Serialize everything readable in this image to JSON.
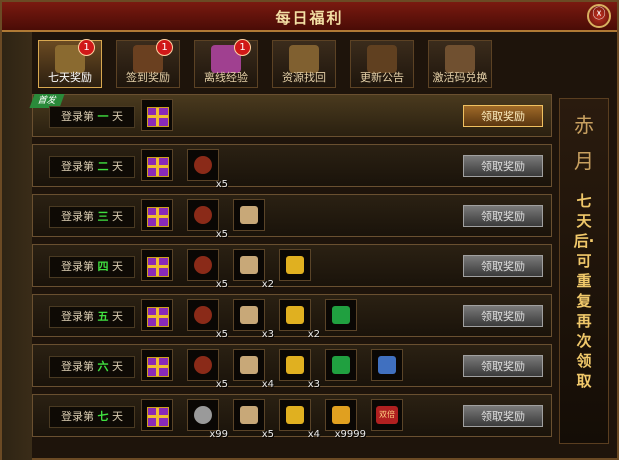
{
  "window": {
    "title": "每日福利",
    "close_label": "ⓧ"
  },
  "tabs": [
    {
      "label": "七天奖励",
      "badge": "1",
      "active": true
    },
    {
      "label": "签到奖励",
      "badge": "1",
      "active": false
    },
    {
      "label": "离线经验",
      "badge": "1",
      "active": false
    },
    {
      "label": "资源找回",
      "badge": "",
      "active": false
    },
    {
      "label": "更新公告",
      "badge": "",
      "active": false
    },
    {
      "label": "激活码兑换",
      "badge": "",
      "active": false
    }
  ],
  "rows": [
    {
      "prefix": "登录第",
      "day": "一",
      "suffix": "天",
      "new_tag": "首发",
      "claim": "领取奖励",
      "items": [
        {
          "icon": "gift-box-icon",
          "qty": ""
        }
      ]
    },
    {
      "prefix": "登录第",
      "day": "二",
      "suffix": "天",
      "claim": "领取奖励",
      "items": [
        {
          "icon": "gift-box-icon",
          "qty": ""
        },
        {
          "icon": "ore-icon",
          "qty": "x5"
        }
      ]
    },
    {
      "prefix": "登录第",
      "day": "三",
      "suffix": "天",
      "claim": "领取奖励",
      "items": [
        {
          "icon": "gift-box-icon",
          "qty": ""
        },
        {
          "icon": "ore-icon",
          "qty": "x5"
        },
        {
          "icon": "scroll-card-icon",
          "qty": ""
        }
      ]
    },
    {
      "prefix": "登录第",
      "day": "四",
      "suffix": "天",
      "claim": "领取奖励",
      "items": [
        {
          "icon": "gift-box-icon",
          "qty": ""
        },
        {
          "icon": "ore-icon",
          "qty": "x5"
        },
        {
          "icon": "scroll-card-icon",
          "qty": "x2"
        },
        {
          "icon": "gold-ingot-icon",
          "qty": ""
        }
      ]
    },
    {
      "prefix": "登录第",
      "day": "五",
      "suffix": "天",
      "claim": "领取奖励",
      "items": [
        {
          "icon": "gift-box-icon",
          "qty": ""
        },
        {
          "icon": "ore-icon",
          "qty": "x5"
        },
        {
          "icon": "scroll-card-icon",
          "qty": "x3"
        },
        {
          "icon": "gold-ingot-icon",
          "qty": "x2"
        },
        {
          "icon": "green-gem-icon",
          "qty": ""
        }
      ]
    },
    {
      "prefix": "登录第",
      "day": "六",
      "suffix": "天",
      "claim": "领取奖励",
      "items": [
        {
          "icon": "gift-box-icon",
          "qty": ""
        },
        {
          "icon": "ore-icon",
          "qty": "x5"
        },
        {
          "icon": "scroll-card-icon",
          "qty": "x4"
        },
        {
          "icon": "gold-ingot-icon",
          "qty": "x3"
        },
        {
          "icon": "green-gem-icon",
          "qty": ""
        },
        {
          "icon": "blue-scroll-icon",
          "qty": ""
        }
      ]
    },
    {
      "prefix": "登录第",
      "day": "七",
      "suffix": "天",
      "claim": "领取奖励",
      "items": [
        {
          "icon": "gift-box-icon",
          "qty": ""
        },
        {
          "icon": "silver-ore-icon",
          "qty": "x99"
        },
        {
          "icon": "scroll-card-icon",
          "qty": "x5"
        },
        {
          "icon": "gold-ingot-icon",
          "qty": "x4"
        },
        {
          "icon": "gold-crystal-icon",
          "qty": "x9999"
        },
        {
          "icon": "double-reward-icon",
          "qty": "",
          "text": "双倍"
        }
      ]
    }
  ],
  "side": {
    "logo": "赤月",
    "note": "七天后·可重复再次领取"
  },
  "colors": {
    "accent": "#f0c86a",
    "day_number": "#40e040",
    "badge": "#d01818"
  }
}
